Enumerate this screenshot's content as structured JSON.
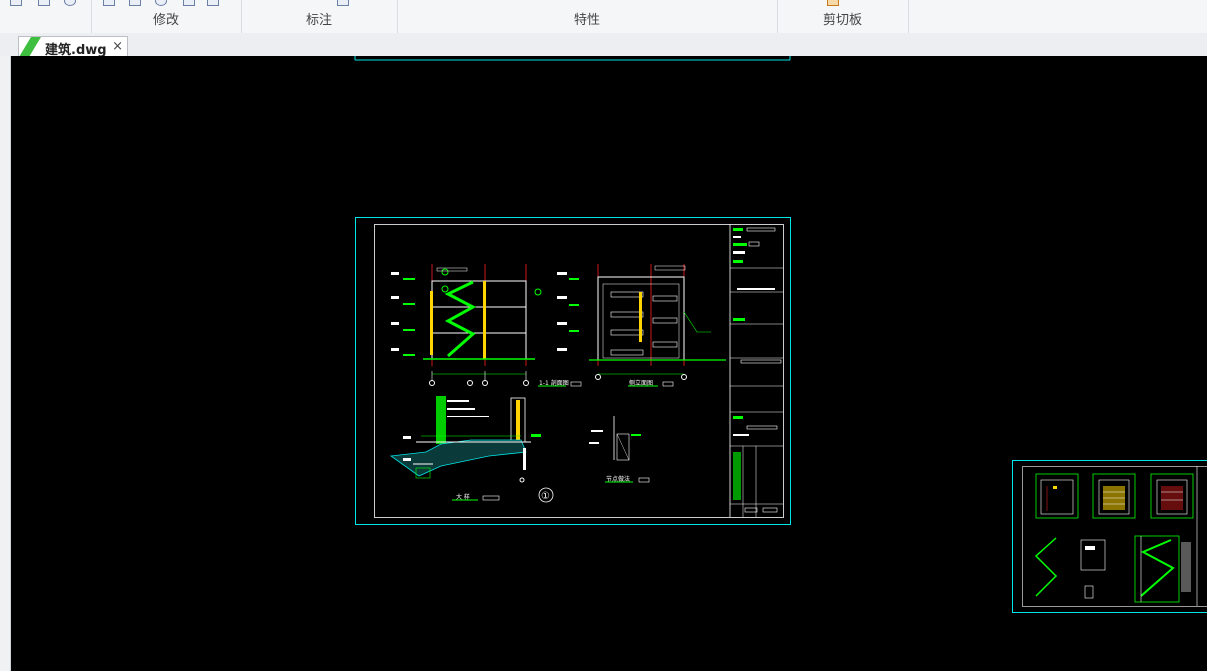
{
  "ribbon": {
    "groups": [
      {
        "label": "修改"
      },
      {
        "label": "标注"
      },
      {
        "label": "特性"
      },
      {
        "label": "剪切板"
      }
    ]
  },
  "document_tab": {
    "label": "建筑.dwg",
    "close_glyph": "×"
  },
  "drawing": {
    "title_section": "1-1 剖面图",
    "title_elevation": "侧立面图",
    "title_detail": "大 样",
    "title_node": "节点做法",
    "callout": "①",
    "colors": {
      "background": "#000000",
      "frame": "#00e5e5",
      "lines": "#ffffff",
      "hatch": "#00ff00",
      "accent": "#ff2020",
      "column": "#ffd400"
    }
  }
}
